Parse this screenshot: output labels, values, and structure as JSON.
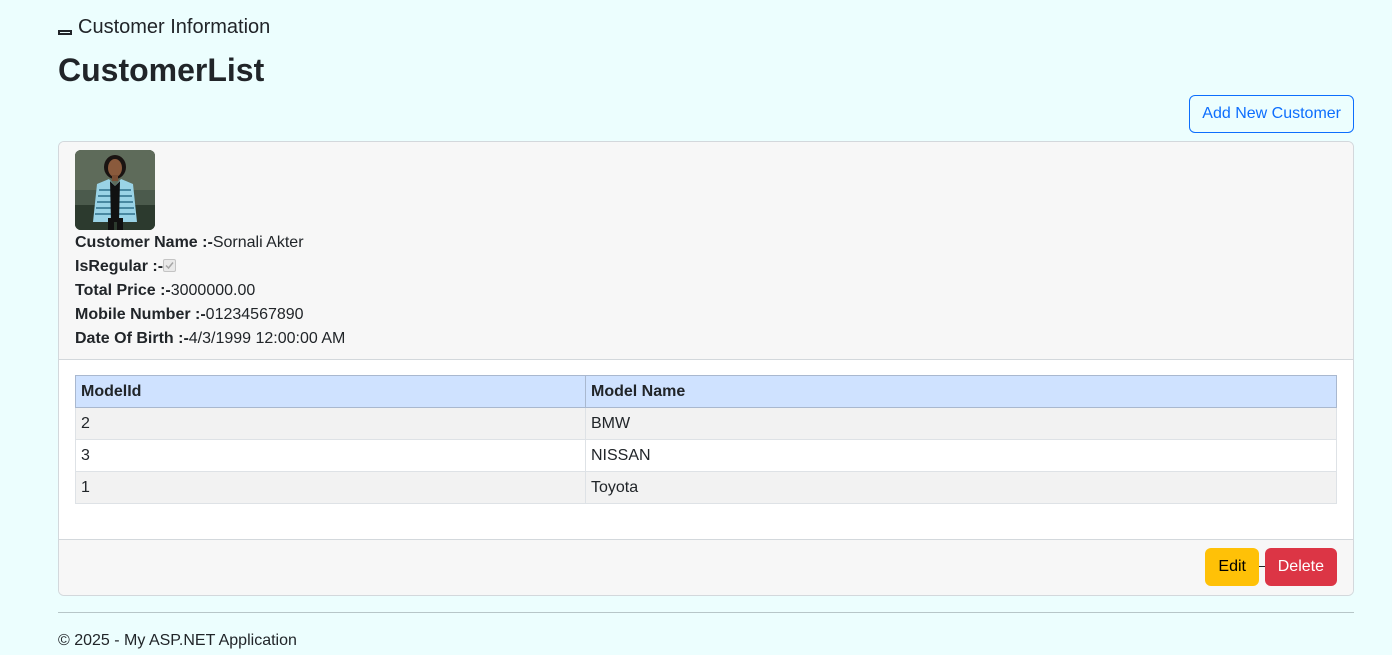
{
  "brand": {
    "title": "Customer Information"
  },
  "page": {
    "title": "CustomerList"
  },
  "actions": {
    "add_label": "Add New Customer"
  },
  "customer": {
    "name_label": "Customer Name :-",
    "name": "Sornali Akter",
    "regular_label": "IsRegular :-",
    "is_regular": true,
    "price_label": "Total Price :-",
    "price": "3000000.00",
    "mobile_label": "Mobile Number :-",
    "mobile": "01234567890",
    "dob_label": "Date Of Birth :-",
    "dob": "4/3/1999 12:00:00 AM"
  },
  "models": {
    "headers": [
      "ModelId",
      "Model Name"
    ],
    "rows": [
      {
        "id": "2",
        "name": "BMW"
      },
      {
        "id": "3",
        "name": "NISSAN"
      },
      {
        "id": "1",
        "name": "Toyota"
      }
    ]
  },
  "card_actions": {
    "edit_label": "Edit",
    "delete_label": "Delete"
  },
  "footer": {
    "text": "© 2025 - My ASP.NET Application"
  },
  "colors": {
    "page_background": "#ecfefe",
    "primary": "#0d6efd",
    "warning": "#ffc107",
    "danger": "#dc3545",
    "table_header": "#cfe2ff"
  }
}
